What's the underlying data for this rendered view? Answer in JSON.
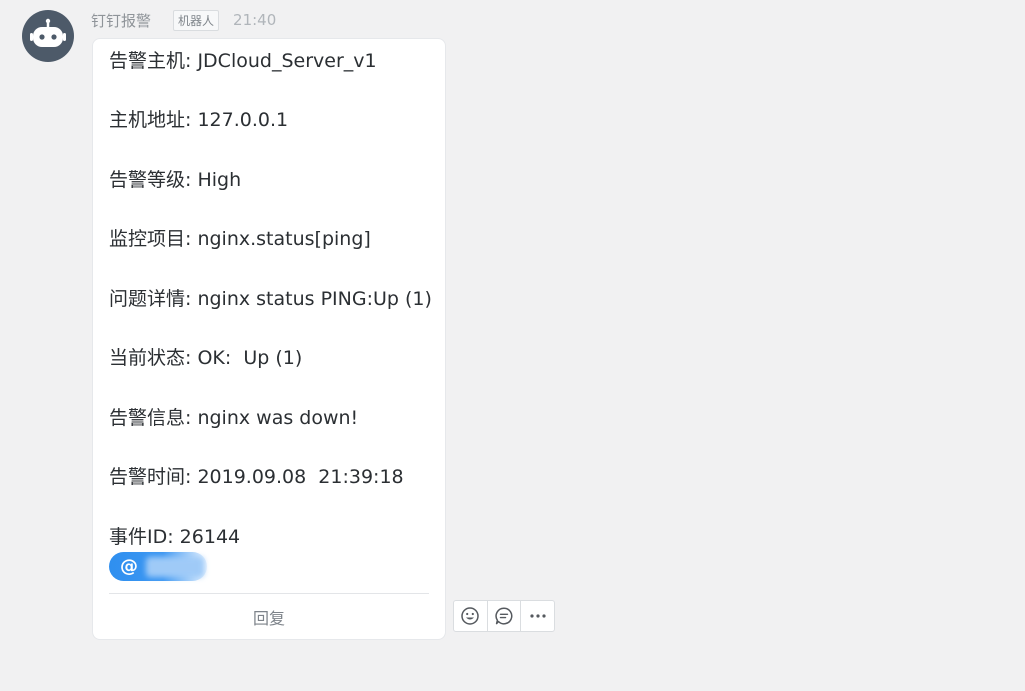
{
  "message": {
    "sender": "钉钉报警",
    "tag": "机器人",
    "time": "21:40",
    "lines": [
      "告警主机: JDCloud_Server_v1",
      "主机地址: 127.0.0.1",
      "告警等级: High",
      "监控项目: nginx.status[ping]",
      "问题详情: nginx status PING:Up (1)",
      "当前状态: OK:  Up (1)",
      "告警信息: nginx was down!",
      "告警时间: 2019.09.08  21:39:18",
      "事件ID: 26144"
    ],
    "mention_prefix": "@",
    "reply_label": "回复"
  },
  "icons": {
    "avatar": "robot-avatar-icon",
    "actions": [
      "emoji-icon",
      "comment-icon",
      "more-icon"
    ]
  },
  "colors": {
    "background": "#f1f1f2",
    "bubble": "#ffffff",
    "mention": "#2f8fef",
    "avatar": "#4d5a69"
  }
}
